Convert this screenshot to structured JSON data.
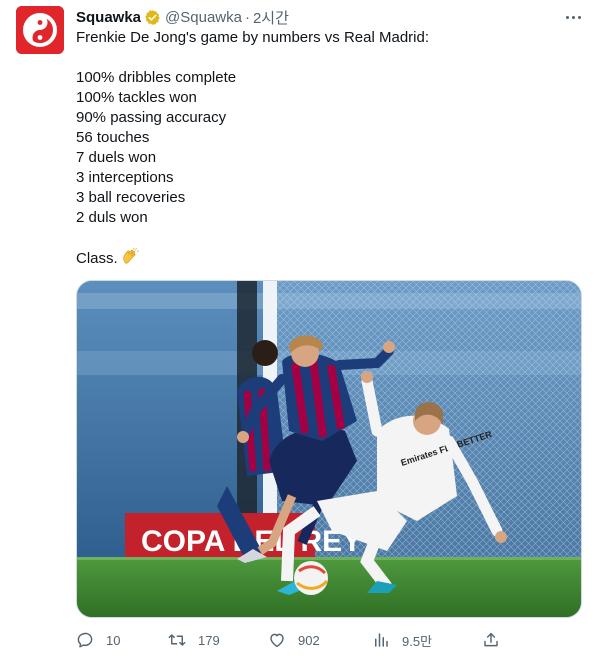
{
  "tweet": {
    "author": {
      "name": "Squawka",
      "handle": "@Squawka",
      "separator": "·",
      "time": "2시간",
      "verified": true,
      "avatar_color": "#e0262b"
    },
    "text_lines": [
      "Frenkie De Jong's game by numbers vs Real Madrid:",
      "",
      "100% dribbles complete",
      "100% tackles won",
      "90% passing accuracy",
      "56 touches",
      "7 duels won",
      "3 interceptions",
      "3 ball recoveries",
      "2 duls won",
      "",
      "Class."
    ],
    "emoji": "clapping-hands",
    "media": {
      "board_text": "COPA DEL REY",
      "shirt_sponsor": "Emirates FLY BETTER"
    },
    "actions": {
      "replies": "10",
      "retweets": "179",
      "likes": "902",
      "views": "9.5만"
    }
  },
  "colors": {
    "text": "#0f1419",
    "secondary": "#536471",
    "brand": "#e0262b",
    "verified_badge": "#e2b719"
  }
}
